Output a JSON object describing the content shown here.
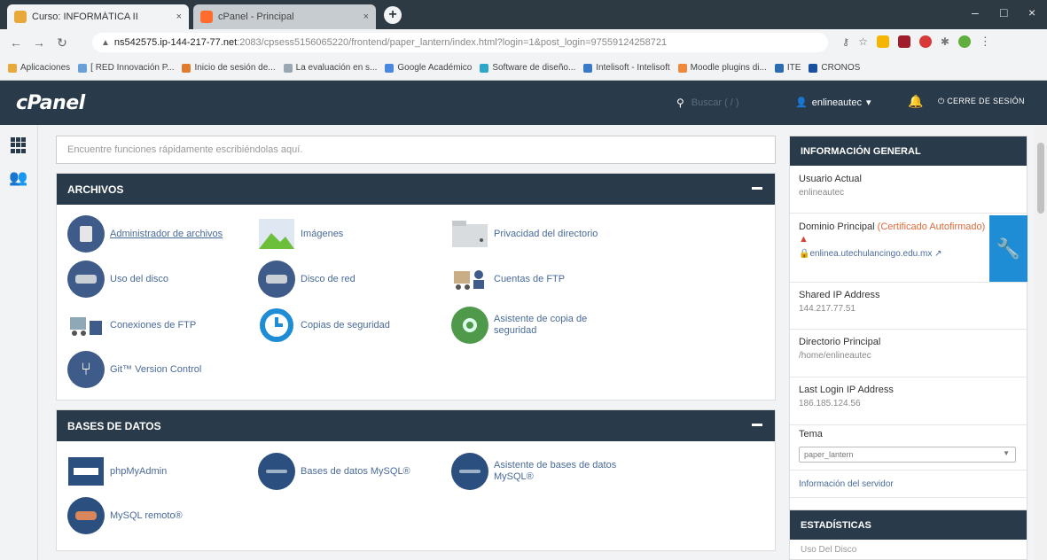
{
  "browser": {
    "tabs": [
      {
        "title": "Curso: INFORMÁTICA II",
        "close": "×",
        "favicon_color": "#e8a93a"
      },
      {
        "title": "cPanel - Principal",
        "close": "×",
        "favicon_color": "#ff6c2c"
      }
    ],
    "new_tab": "+",
    "window_controls": [
      "–",
      "□",
      "×"
    ],
    "url_host": "ns542575.ip-144-217-77.net",
    "url_path": ":2083/cpsess5156065220/frontend/paper_lantern/index.html?login=1&post_login=97559124258721",
    "bookmarks": [
      {
        "label": "Aplicaciones",
        "color": "#e8a93a"
      },
      {
        "label": "[ RED Innovación P...",
        "color": "#6aa0d8"
      },
      {
        "label": "Inicio de sesión de...",
        "color": "#e07b2e"
      },
      {
        "label": "La evaluación en s...",
        "color": "#9aa6b2"
      },
      {
        "label": "Google Académico",
        "color": "#4a88e0"
      },
      {
        "label": "Software de diseño...",
        "color": "#2ea6c9"
      },
      {
        "label": "Intelisoft - Intelisoft",
        "color": "#3a7bc8"
      },
      {
        "label": "Moodle plugins di...",
        "color": "#f0883a"
      },
      {
        "label": "ITE",
        "color": "#2b6cb0"
      },
      {
        "label": "CRONOS",
        "color": "#1a4fa0"
      }
    ]
  },
  "header": {
    "logo": "cPanel",
    "search_placeholder": "Buscar ( / )",
    "user": "enlineautec",
    "logout": "CERRE DE SESIÓN"
  },
  "main": {
    "search_placeholder": "Encuentre funciones rápidamente escribiéndolas aquí.",
    "archivos": {
      "title": "ARCHIVOS",
      "items": [
        "Administrador de archivos",
        "Imágenes",
        "Privacidad del directorio",
        "Uso del disco",
        "Disco de red",
        "Cuentas de FTP",
        "Conexiones de FTP",
        "Copias de seguridad",
        "Asistente de copia de seguridad",
        "Git™ Version Control"
      ]
    },
    "bases": {
      "title": "BASES DE DATOS",
      "items": [
        "phpMyAdmin",
        "Bases de datos MySQL®",
        "Asistente de bases de datos MySQL®",
        "MySQL remoto®"
      ]
    }
  },
  "sidebar": {
    "title": "INFORMACIÓN GENERAL",
    "current_user_label": "Usuario Actual",
    "current_user": "enlineautec",
    "domain_label": "Dominio Principal",
    "domain_cert": "(Certificado Autofirmado)",
    "domain_value": "enlinea.utechulancingo.edu.mx",
    "shared_ip_label": "Shared IP Address",
    "shared_ip": "144.217.77.51",
    "home_dir_label": "Directorio Principal",
    "home_dir": "/home/enlineautec",
    "last_login_label": "Last Login IP Address",
    "last_login": "186.185.124.56",
    "theme_label": "Tema",
    "theme_value": "paper_lantern",
    "server_info": "Información del servidor",
    "stats_title": "ESTADÍSTICAS",
    "stats_sub": "Uso Del Disco"
  },
  "colors": {
    "header": "#293a4a",
    "link": "#4a6a9a",
    "accent": "#1f8cd6"
  }
}
